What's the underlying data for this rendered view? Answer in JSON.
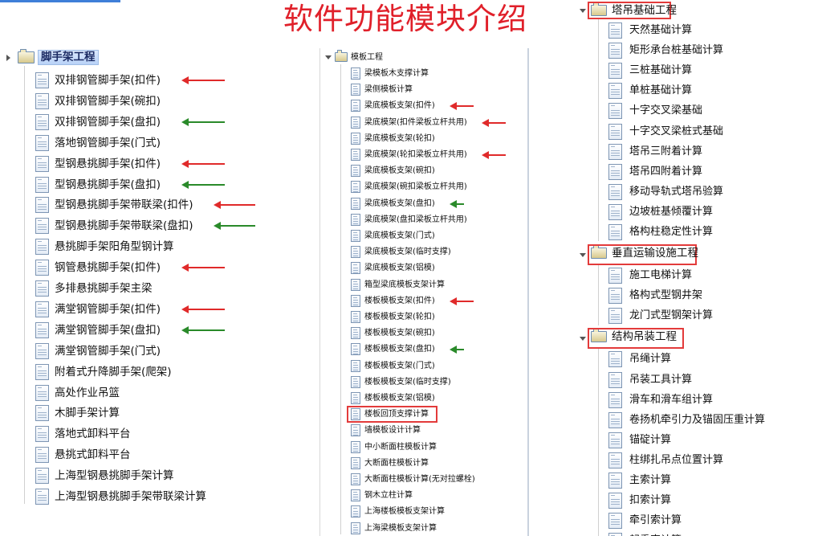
{
  "title": "软件功能模块介绍",
  "colors": {
    "title": "#e0202a",
    "accent_arrow_red": "#e02a2a",
    "accent_arrow_green": "#2a8a2a",
    "highlight": "#b9d2f7"
  },
  "panel_left": {
    "root": "脚手架工程",
    "items": [
      {
        "label": "双排钢管脚手架(扣件)",
        "arrow": "red"
      },
      {
        "label": "双排钢管脚手架(碗扣)",
        "arrow": ""
      },
      {
        "label": "双排钢管脚手架(盘扣)",
        "arrow": "green"
      },
      {
        "label": "落地钢管脚手架(门式)",
        "arrow": ""
      },
      {
        "label": "型钢悬挑脚手架(扣件)",
        "arrow": "red"
      },
      {
        "label": "型钢悬挑脚手架(盘扣)",
        "arrow": "green"
      },
      {
        "label": "型钢悬挑脚手架带联梁(扣件)",
        "arrow": "red"
      },
      {
        "label": "型钢悬挑脚手架带联梁(盘扣)",
        "arrow": "green"
      },
      {
        "label": "悬挑脚手架阳角型钢计算",
        "arrow": ""
      },
      {
        "label": "钢管悬挑脚手架(扣件)",
        "arrow": "red"
      },
      {
        "label": "多排悬挑脚手架主梁",
        "arrow": ""
      },
      {
        "label": "满堂钢管脚手架(扣件)",
        "arrow": "red"
      },
      {
        "label": "满堂钢管脚手架(盘扣)",
        "arrow": "green"
      },
      {
        "label": "满堂钢管脚手架(门式)",
        "arrow": ""
      },
      {
        "label": "附着式升降脚手架(爬架)",
        "arrow": ""
      },
      {
        "label": "高处作业吊篮",
        "arrow": ""
      },
      {
        "label": "木脚手架计算",
        "arrow": ""
      },
      {
        "label": "落地式卸料平台",
        "arrow": ""
      },
      {
        "label": "悬挑式卸料平台",
        "arrow": ""
      },
      {
        "label": "上海型钢悬挑脚手架计算",
        "arrow": ""
      },
      {
        "label": "上海型钢悬挑脚手架带联梁计算",
        "arrow": ""
      }
    ]
  },
  "panel_middle": {
    "root": "模板工程",
    "items": [
      {
        "label": "梁模板木支撑计算",
        "arrow": ""
      },
      {
        "label": "梁侧模板计算",
        "arrow": ""
      },
      {
        "label": "梁底模板支架(扣件)",
        "arrow": "red"
      },
      {
        "label": "梁底模架(扣件梁板立杆共用)",
        "arrow": "red"
      },
      {
        "label": "梁底模板支架(轮扣)",
        "arrow": ""
      },
      {
        "label": "梁底模架(轮扣梁板立杆共用)",
        "arrow": "red"
      },
      {
        "label": "梁底模板支架(碗扣)",
        "arrow": ""
      },
      {
        "label": "梁底模架(碗扣梁板立杆共用)",
        "arrow": ""
      },
      {
        "label": "梁底模板支架(盘扣)",
        "arrow": "green"
      },
      {
        "label": "梁底模架(盘扣梁板立杆共用)",
        "arrow": ""
      },
      {
        "label": "梁底模板支架(门式)",
        "arrow": ""
      },
      {
        "label": "梁底模板支架(临时支撑)",
        "arrow": ""
      },
      {
        "label": "梁底模板支架(铝模)",
        "arrow": ""
      },
      {
        "label": "箱型梁底模板支架计算",
        "arrow": ""
      },
      {
        "label": "楼板模板支架(扣件)",
        "arrow": "red"
      },
      {
        "label": "楼板模板支架(轮扣)",
        "arrow": ""
      },
      {
        "label": "楼板模板支架(碗扣)",
        "arrow": ""
      },
      {
        "label": "楼板模板支架(盘扣)",
        "arrow": "green"
      },
      {
        "label": "楼板模板支架(门式)",
        "arrow": ""
      },
      {
        "label": "楼板模板支架(临时支撑)",
        "arrow": ""
      },
      {
        "label": "楼板模板支架(铝模)",
        "arrow": ""
      },
      {
        "label": "楼板回顶支撑计算",
        "arrow": "",
        "boxed": true
      },
      {
        "label": "墙模板设计计算",
        "arrow": ""
      },
      {
        "label": "中小断面柱模板计算",
        "arrow": ""
      },
      {
        "label": "大断面柱模板计算",
        "arrow": ""
      },
      {
        "label": "大断面柱模板计算(无对拉螺栓)",
        "arrow": ""
      },
      {
        "label": "钢木立柱计算",
        "arrow": ""
      },
      {
        "label": "上海楼板模板支架计算",
        "arrow": ""
      },
      {
        "label": "上海梁模板支架计算",
        "arrow": ""
      }
    ]
  },
  "panel_right": {
    "groups": [
      {
        "root": "塔吊基础工程",
        "items": [
          "天然基础计算",
          "矩形承台桩基础计算",
          "三桩基础计算",
          "单桩基础计算",
          "十字交叉梁基础",
          "十字交叉梁桩式基础",
          "塔吊三附着计算",
          "塔吊四附着计算",
          "移动导轨式塔吊验算",
          "边坡桩基倾覆计算",
          "格构柱稳定性计算"
        ]
      },
      {
        "root": "垂直运输设施工程",
        "items": [
          "施工电梯计算",
          "格构式型钢井架",
          "龙门式型钢架计算"
        ]
      },
      {
        "root": "结构吊装工程",
        "items": [
          "吊绳计算",
          "吊装工具计算",
          "滑车和滑车组计算",
          "卷扬机牵引力及锚固压重计算",
          "锚碇计算",
          "柱绑扎吊点位置计算",
          "主索计算",
          "扣索计算",
          "牵引索计算",
          "起重索计算"
        ]
      }
    ]
  }
}
